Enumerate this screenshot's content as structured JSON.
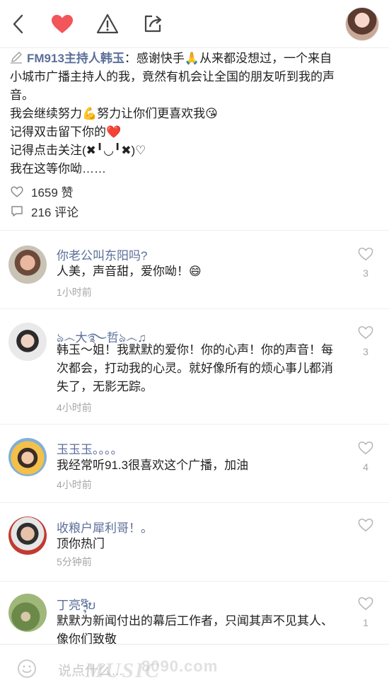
{
  "post": {
    "author": "FM913主持人韩玉",
    "lines": [
      "：感谢快手🙏从来都没想过，一个来自",
      "小城市广播主持人的我，竟然有机会让全国的朋友听到我的声",
      "音。",
      "我会继续努力💪努力让你们更喜欢我😘",
      "记得双击留下你的❤️",
      "记得点击关注(✖╹◡╹✖)♡",
      "我在这等你呦……"
    ],
    "likes": "1659 赞",
    "comments": "216 评论"
  },
  "comments": [
    {
      "name": "你老公叫东阳吗?",
      "text": "人美，声音甜，爱你呦！😄",
      "time": "1小时前",
      "likes": "3"
    },
    {
      "name": "ঌ෴大࿐哲ঌ෴♫",
      "text": "韩玉～姐！我默默的爱你！你的心声！你的声音！每次都会，打动我的心灵。就好像所有的烦心事儿都消失了，无影无踪。",
      "time": "4小时前",
      "likes": "3"
    },
    {
      "name": "玉玉玉。。。。",
      "text": "我经常听91.3很喜欢这个广播，加油",
      "time": "4小时前",
      "likes": "4"
    },
    {
      "name": "收粮户犀利哥！。",
      "text": "顶你热门",
      "time": "5分钟前",
      "likes": ""
    },
    {
      "name": "丁亮ຈຸ໊ບ",
      "text": "默默为新闻付出的幕后工作者，只闻其声不见其人、像你们致敬",
      "time": "",
      "likes": "1"
    }
  ],
  "input": {
    "placeholder": "说点什么..."
  },
  "watermark": {
    "text": "MUSIC",
    "sub": "8090.com"
  },
  "colors": {
    "accent": "#5b6f99",
    "heart": "#f2555a"
  },
  "icons": [
    "back-icon",
    "heart-icon",
    "report-icon",
    "share-icon",
    "pencil-icon",
    "like-icon",
    "comment-icon",
    "emoji-icon"
  ]
}
